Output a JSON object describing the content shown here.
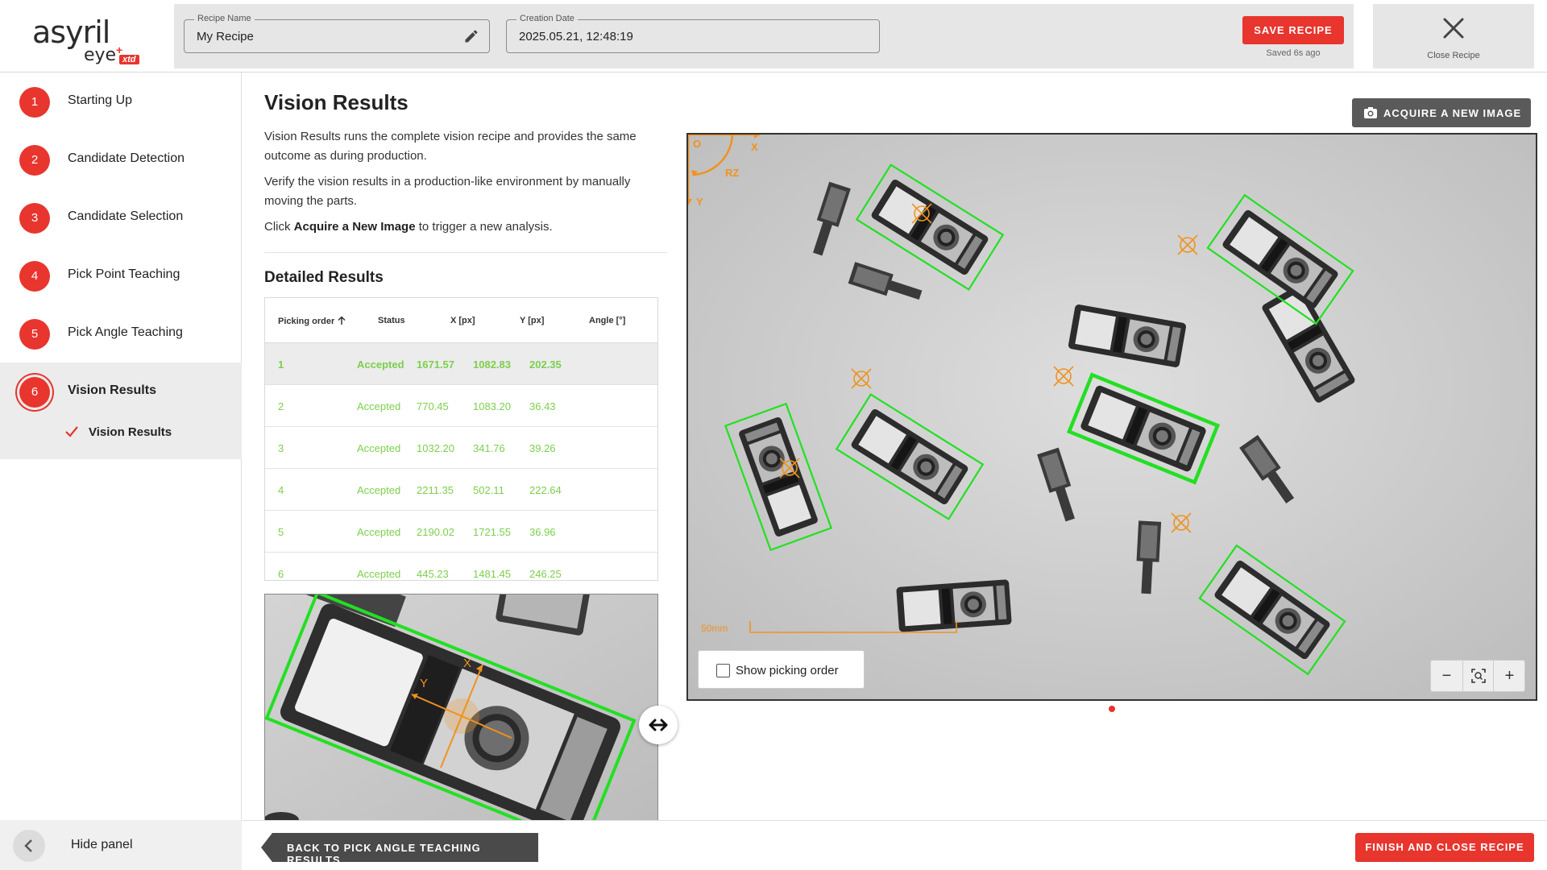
{
  "header": {
    "logo": {
      "brand": "asyril",
      "product": "eye",
      "plus": "+",
      "edition": "xtd"
    },
    "recipe_name": {
      "label": "Recipe Name",
      "value": "My Recipe"
    },
    "creation_date": {
      "label": "Creation Date",
      "value": "2025.05.21, 12:48:19"
    },
    "save_button": "SAVE RECIPE",
    "saved_status": "Saved 6s ago",
    "close_label": "Close Recipe"
  },
  "sidebar": {
    "steps": [
      {
        "number": "1",
        "label": "Starting Up"
      },
      {
        "number": "2",
        "label": "Candidate Detection"
      },
      {
        "number": "3",
        "label": "Candidate Selection"
      },
      {
        "number": "4",
        "label": "Pick Point Teaching"
      },
      {
        "number": "5",
        "label": "Pick Angle Teaching"
      },
      {
        "number": "6",
        "label": "Vision Results"
      }
    ],
    "active_substep": "Vision Results",
    "hide_panel": "Hide panel"
  },
  "main": {
    "title": "Vision Results",
    "paragraph1": "Vision Results runs the complete vision recipe and provides the same outcome as during production.",
    "paragraph2": "Verify the vision results in a production-like environment by manually moving the parts.",
    "paragraph3_prefix": "Click ",
    "paragraph3_bold": "Acquire a New Image",
    "paragraph3_suffix": " to trigger a new analysis.",
    "detailed_title": "Detailed Results",
    "table": {
      "headers": [
        "Picking order",
        "Status",
        "X [px]",
        "Y [px]",
        "Angle [°]"
      ],
      "rows": [
        [
          "1",
          "Accepted",
          "1671.57",
          "1082.83",
          "202.35"
        ],
        [
          "2",
          "Accepted",
          "770.45",
          "1083.20",
          "36.43"
        ],
        [
          "3",
          "Accepted",
          "1032.20",
          "341.76",
          "39.26"
        ],
        [
          "4",
          "Accepted",
          "2211.35",
          "502.11",
          "222.64"
        ],
        [
          "5",
          "Accepted",
          "2190.02",
          "1721.55",
          "36.96"
        ],
        [
          "6",
          "Accepted",
          "445.23",
          "1481.45",
          "246.25"
        ]
      ]
    }
  },
  "viewer": {
    "acquire_button": "ACQUIRE A NEW IMAGE",
    "axis_origin": "O",
    "axis_x": "X",
    "axis_y": "Y",
    "axis_rz": "RZ",
    "scale_label": "50mm",
    "show_picking_order": "Show picking order",
    "zoom_out": "−",
    "zoom_in": "+"
  },
  "zoom_view": {
    "axis_x": "X",
    "axis_y": "Y"
  },
  "footer": {
    "back_button": "BACK TO PICK ANGLE TEACHING RESULTS",
    "finish_button": "FINISH AND CLOSE RECIPE"
  },
  "colors": {
    "accent": "#e8352e",
    "accepted": "#7ccf4c",
    "detection_box": "#22e022",
    "axis": "#f0921e"
  }
}
